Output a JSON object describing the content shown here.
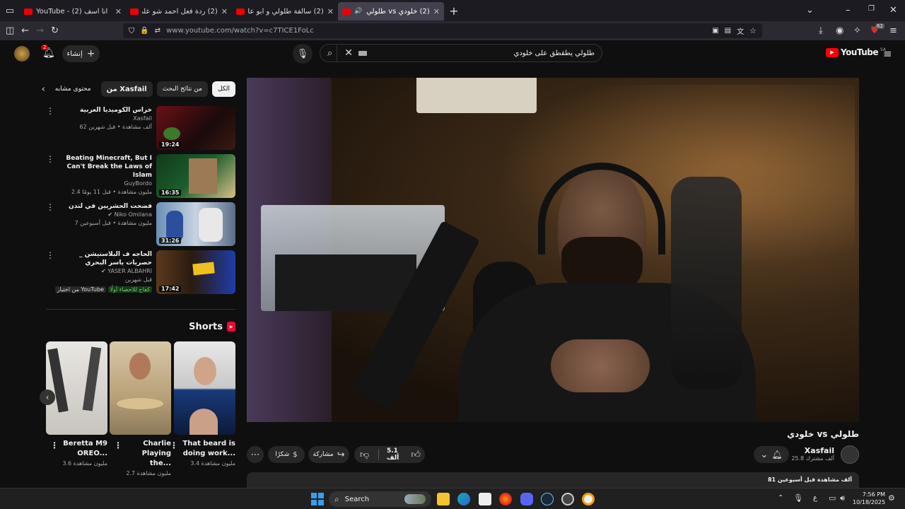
{
  "browser": {
    "tabs": [
      {
        "title": "انا اسف (2) - YouTube",
        "active": false
      },
      {
        "title": "(2) ردة فعل احمد شو على اغنية",
        "active": false
      },
      {
        "title": "(2) سالفة طلولي و ابو عابد كاملة",
        "active": false
      },
      {
        "title": "(2) خلودي vs طلولي - YouTube",
        "active": true
      }
    ],
    "url": "www.youtube.com/watch?v=c7TICE1FoLc",
    "ext_badge": "62"
  },
  "youtube": {
    "logo": "YouTube",
    "region": "SA",
    "search_value": "طلولي يطقطق على خلودي",
    "create_label": "إنشاء",
    "notif_count": "2",
    "chips": [
      "الكل",
      "من نتائج البحث",
      "من Xasfail",
      "محتوى مشابه"
    ]
  },
  "related": [
    {
      "title": "خراس الكوميديا العربية",
      "channel": "Xasfail",
      "meta": "62 ألف مشاهدة • قبل شهرين",
      "duration": "19:24",
      "verified": false
    },
    {
      "title": "Beating Minecraft, But I Can't Break the Laws of Islam",
      "channel": "GuyBordo",
      "meta": "2.4 مليون مشاهدة • قبل 11 يومًا",
      "duration": "16:35",
      "verified": false
    },
    {
      "title": "فضحت الحشريين في لندن",
      "channel": "Niko Omilana",
      "meta": "7 مليون مشاهدة • قبل أسبوعين",
      "duration": "31:26",
      "verified": true
    },
    {
      "title": "الحاجه ف البلاستيشن _ حصريات ياسر البحري",
      "channel": "YASER ALBAHRI",
      "meta": "قبل شهرين",
      "duration": "17:42",
      "verified": true,
      "badge": "من اختيار YouTube",
      "badge2": "كفاح للاحصاء أولًا"
    }
  ],
  "shorts": {
    "heading": "Shorts",
    "items": [
      {
        "title": "That beard is doing work...",
        "views": "3.4 مليون مشاهدة"
      },
      {
        "title": "Charlie Playing the...",
        "views": "2.7 مليون مشاهدة"
      },
      {
        "title": "Beretta M9 OREO...",
        "views": "3.6 مليون مشاهدة"
      }
    ]
  },
  "video": {
    "title": "خلودي vs طلولي",
    "channel": "Xasfail",
    "subscribers": "25.8 ألف مشترك",
    "likes": "5.1 ألف",
    "share_label": "مشاركة",
    "thanks_label": "شكرًا",
    "views_line": "81 ألف مشاهدة  قبل أسبوعين"
  },
  "taskbar": {
    "search_label": "Search",
    "time": "7:56 PM",
    "date": "10/18/2025",
    "lang": "ع"
  }
}
